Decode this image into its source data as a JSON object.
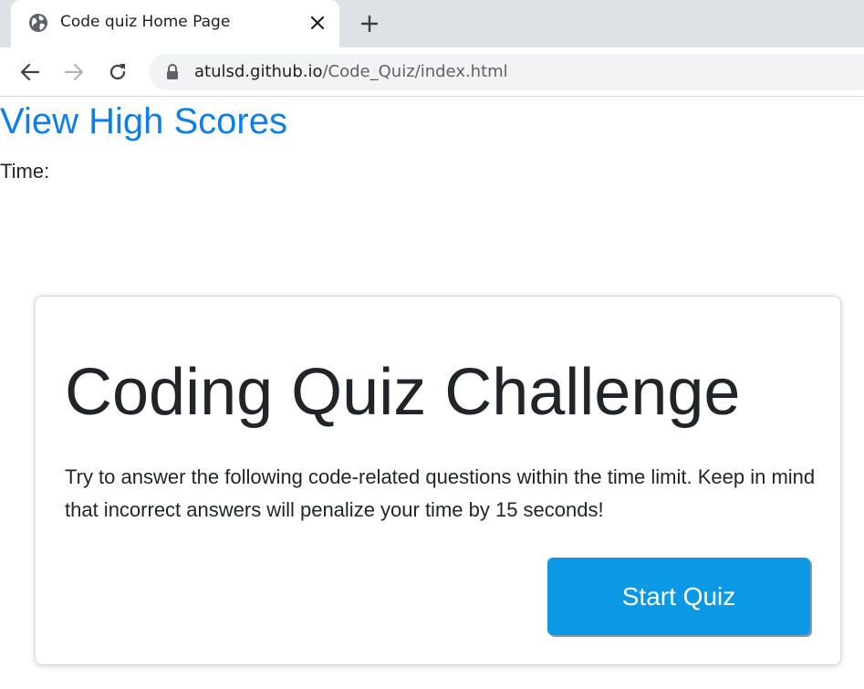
{
  "browser": {
    "tab": {
      "title": "Code quiz Home Page",
      "favicon": "globe-icon",
      "close_icon": "close-icon"
    },
    "new_tab_icon": "plus-icon",
    "nav": {
      "back_icon": "arrow-left-icon",
      "forward_icon": "arrow-right-icon",
      "reload_icon": "reload-icon"
    },
    "address": {
      "lock_icon": "lock-icon",
      "domain": "atulsd.github.io",
      "path": "/Code_Quiz/index.html"
    }
  },
  "page": {
    "high_scores_link": "View High Scores",
    "timer_label": "Time:",
    "card": {
      "title": "Coding Quiz Challenge",
      "description": "Try to answer the following code-related questions within the time limit. Keep in mind that incorrect answers will penalize your time by 15 seconds!",
      "start_button": "Start Quiz"
    }
  },
  "colors": {
    "link": "#0d7fe8",
    "button": "#0b99e6",
    "text": "#212529",
    "tabstrip": "#dee1e6",
    "omnibox": "#f1f3f4"
  }
}
